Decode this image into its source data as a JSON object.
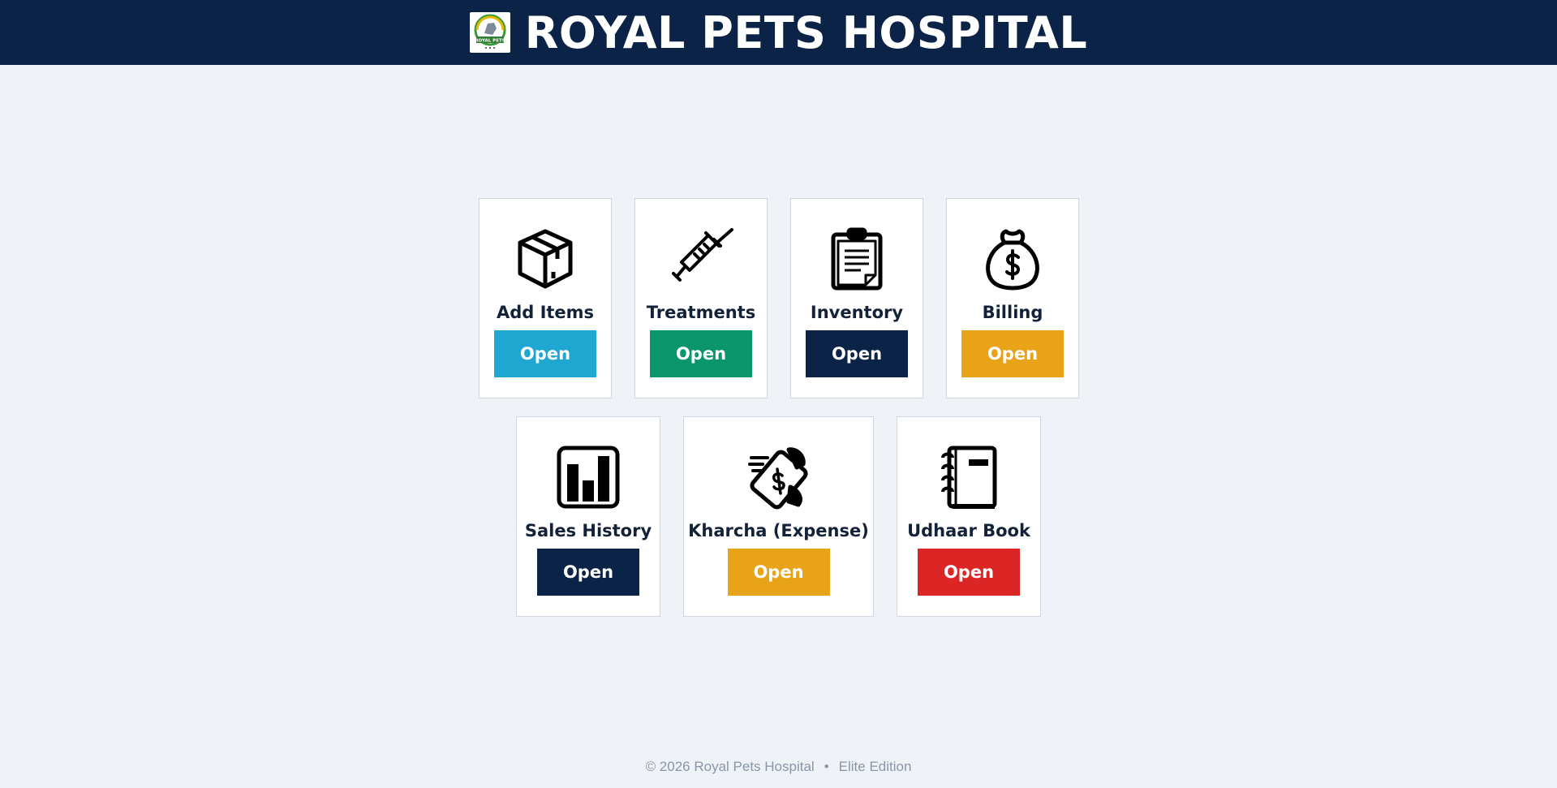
{
  "header": {
    "title": "ROYAL PETS HOSPITAL",
    "logo_text": "ROYAL PETS"
  },
  "cards": [
    {
      "label": "Add Items",
      "button": "Open",
      "icon": "box-icon",
      "color": "#1ea8d1"
    },
    {
      "label": "Treatments",
      "button": "Open",
      "icon": "syringe-icon",
      "color": "#0a956b"
    },
    {
      "label": "Inventory",
      "button": "Open",
      "icon": "clipboard-icon",
      "color": "#0c2348"
    },
    {
      "label": "Billing",
      "button": "Open",
      "icon": "money-bag-icon",
      "color": "#e8a319"
    },
    {
      "label": "Sales History",
      "button": "Open",
      "icon": "bar-chart-icon",
      "color": "#0c2348"
    },
    {
      "label": "Kharcha (Expense)",
      "button": "Open",
      "icon": "cash-hand-icon",
      "color": "#e8a319"
    },
    {
      "label": "Udhaar Book",
      "button": "Open",
      "icon": "notebook-icon",
      "color": "#dc2626"
    }
  ],
  "footer": {
    "copyright": "© 2026 Royal Pets Hospital",
    "separator": "•",
    "edition": "Elite Edition"
  }
}
